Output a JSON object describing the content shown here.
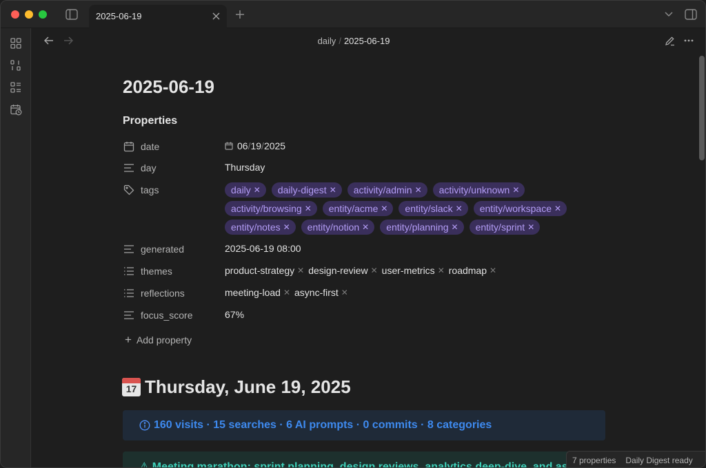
{
  "tab": {
    "title": "2025-06-19"
  },
  "breadcrumb": {
    "parent": "daily",
    "separator": "/",
    "current": "2025-06-19"
  },
  "note": {
    "title": "2025-06-19"
  },
  "properties": {
    "heading": "Properties",
    "date": {
      "key": "date",
      "month": "06",
      "day": "19",
      "year": "2025",
      "sep": "/"
    },
    "day": {
      "key": "day",
      "value": "Thursday"
    },
    "tags": {
      "key": "tags",
      "items": [
        "daily",
        "daily-digest",
        "activity/admin",
        "activity/unknown",
        "activity/browsing",
        "entity/acme",
        "entity/slack",
        "entity/workspace",
        "entity/notes",
        "entity/notion",
        "entity/planning",
        "entity/sprint"
      ]
    },
    "generated": {
      "key": "generated",
      "value": "2025-06-19 08:00"
    },
    "themes": {
      "key": "themes",
      "items": [
        "product-strategy",
        "design-review",
        "user-metrics",
        "roadmap"
      ]
    },
    "reflections": {
      "key": "reflections",
      "items": [
        "meeting-load",
        "async-first"
      ]
    },
    "focus_score": {
      "key": "focus_score",
      "value": "67%"
    },
    "add_label": "Add property"
  },
  "heading1": {
    "text": "Thursday, June 19, 2025",
    "emoji_day": "17"
  },
  "callout_info": {
    "text": "160 visits · 15 searches · 6 AI prompts · 0 commits · 8 categories"
  },
  "callout_green": {
    "text": "⚠ Meeting marathon: sprint planning, design reviews, analytics deep-dive, and as"
  },
  "status": {
    "properties": "7 properties",
    "plugin": "Daily Digest ready"
  },
  "colors": {
    "tag_bg": "#3a2f5b",
    "tag_fg": "#b39cf5",
    "info": "#3e8aef",
    "success": "#3ecfb8"
  },
  "icons": [
    "sidebar-toggle-icon",
    "close-icon",
    "plus-icon",
    "chevron-down-icon",
    "right-sidebar-icon",
    "files-icon",
    "compare-icon",
    "bookmarks-icon",
    "calendar-clock-icon",
    "arrow-left-icon",
    "arrow-right-icon",
    "pencil-icon",
    "more-icon",
    "calendar-icon",
    "text-icon",
    "tag-icon",
    "list-icon",
    "info-icon"
  ]
}
